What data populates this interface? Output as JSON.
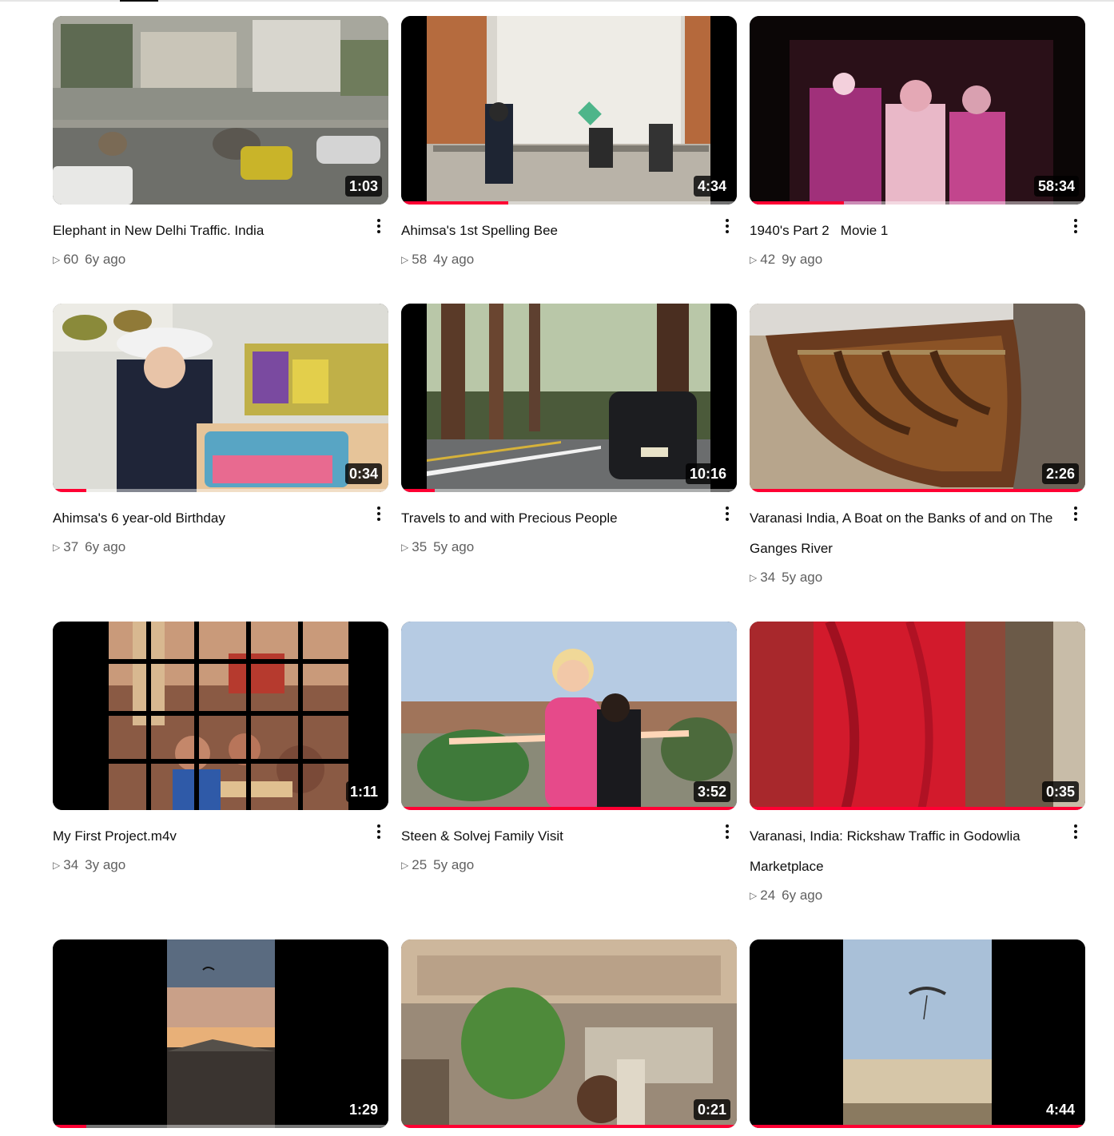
{
  "videos": [
    {
      "title": "Elephant in New Delhi Traffic. India",
      "duration": "1:03",
      "views": "60",
      "age": "6y ago",
      "progress": 0
    },
    {
      "title": "Ahimsa's 1st Spelling Bee",
      "duration": "4:34",
      "views": "58",
      "age": "4y ago",
      "progress": 0.32
    },
    {
      "title": "1940's Part 2   Movie 1",
      "duration": "58:34",
      "views": "42",
      "age": "9y ago",
      "progress": 0.28
    },
    {
      "title": "Ahimsa's 6 year-old Birthday",
      "duration": "0:34",
      "views": "37",
      "age": "6y ago",
      "progress": 0.1
    },
    {
      "title": "Travels to and with Precious People",
      "duration": "10:16",
      "views": "35",
      "age": "5y ago",
      "progress": 0.1
    },
    {
      "title": "Varanasi India, A Boat on the Banks of and on The Ganges River",
      "duration": "2:26",
      "views": "34",
      "age": "5y ago",
      "progress": 1.0
    },
    {
      "title": "My First Project.m4v",
      "duration": "1:11",
      "views": "34",
      "age": "3y ago",
      "progress": 0
    },
    {
      "title": "Steen & Solvej Family Visit",
      "duration": "3:52",
      "views": "25",
      "age": "5y ago",
      "progress": 1.0
    },
    {
      "title": "Varanasi, India: Rickshaw Traffic in Godowlia Marketplace",
      "duration": "0:35",
      "views": "24",
      "age": "6y ago",
      "progress": 1.0
    },
    {
      "title": "",
      "duration": "1:29",
      "views": "",
      "age": "",
      "progress": 0.1
    },
    {
      "title": "",
      "duration": "0:21",
      "views": "",
      "age": "",
      "progress": 1.0
    },
    {
      "title": "",
      "duration": "4:44",
      "views": "",
      "age": "",
      "progress": 1.0
    }
  ],
  "icons": {
    "play": "play-triangle-icon",
    "menu": "more-vert-icon"
  },
  "colors": {
    "progress": "#ff0033",
    "meta_text": "#606060",
    "title_text": "#0f0f0f"
  }
}
